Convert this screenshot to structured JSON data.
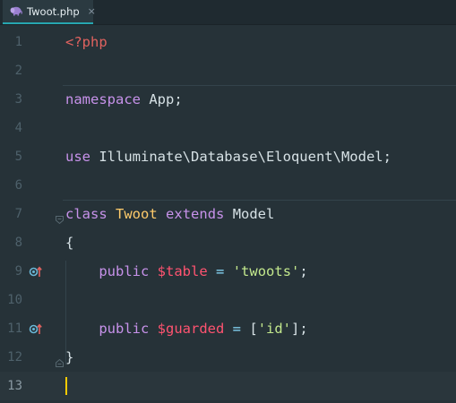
{
  "tab": {
    "icon": "php-elephant-icon",
    "label": "Twoot.php",
    "close": "×"
  },
  "colors": {
    "background": "#263238",
    "keyword": "#c792ea",
    "class_name": "#ffcb6b",
    "variable": "#ff5370",
    "string": "#c3e88d",
    "php_tag": "#e0625f",
    "caret": "#ffcc00"
  },
  "editor": {
    "current_line": 13,
    "lines": [
      {
        "n": "1",
        "t": [
          {
            "k": "php_tag",
            "v": "<?php"
          }
        ]
      },
      {
        "n": "2",
        "t": []
      },
      {
        "n": "3",
        "t": [
          {
            "k": "keyword",
            "v": "namespace"
          },
          {
            "k": "plain",
            "v": " App;"
          }
        ]
      },
      {
        "n": "4",
        "t": []
      },
      {
        "n": "5",
        "t": [
          {
            "k": "keyword",
            "v": "use"
          },
          {
            "k": "plain",
            "v": " Illuminate\\Database\\Eloquent\\Model;"
          }
        ]
      },
      {
        "n": "6",
        "t": []
      },
      {
        "n": "7",
        "t": [
          {
            "k": "keyword",
            "v": "class"
          },
          {
            "k": "plain",
            "v": " "
          },
          {
            "k": "class_name",
            "v": "Twoot"
          },
          {
            "k": "plain",
            "v": " "
          },
          {
            "k": "keyword",
            "v": "extends"
          },
          {
            "k": "plain",
            "v": " Model"
          }
        ]
      },
      {
        "n": "8",
        "t": [
          {
            "k": "plain",
            "v": "{"
          }
        ]
      },
      {
        "n": "9",
        "icon": "override-property-icon",
        "t": [
          {
            "k": "plain",
            "v": "    "
          },
          {
            "k": "keyword",
            "v": "public"
          },
          {
            "k": "plain",
            "v": " "
          },
          {
            "k": "variable",
            "v": "$table"
          },
          {
            "k": "plain",
            "v": " "
          },
          {
            "k": "operator",
            "v": "="
          },
          {
            "k": "plain",
            "v": " "
          },
          {
            "k": "string",
            "v": "'twoots'"
          },
          {
            "k": "plain",
            "v": ";"
          }
        ]
      },
      {
        "n": "10",
        "t": []
      },
      {
        "n": "11",
        "icon": "override-property-icon",
        "t": [
          {
            "k": "plain",
            "v": "    "
          },
          {
            "k": "keyword",
            "v": "public"
          },
          {
            "k": "plain",
            "v": " "
          },
          {
            "k": "variable",
            "v": "$guarded"
          },
          {
            "k": "plain",
            "v": " "
          },
          {
            "k": "operator",
            "v": "="
          },
          {
            "k": "plain",
            "v": " ["
          },
          {
            "k": "string",
            "v": "'id'"
          },
          {
            "k": "plain",
            "v": "];"
          }
        ]
      },
      {
        "n": "12",
        "t": [
          {
            "k": "plain",
            "v": "}"
          }
        ]
      },
      {
        "n": "13",
        "t": []
      }
    ]
  }
}
